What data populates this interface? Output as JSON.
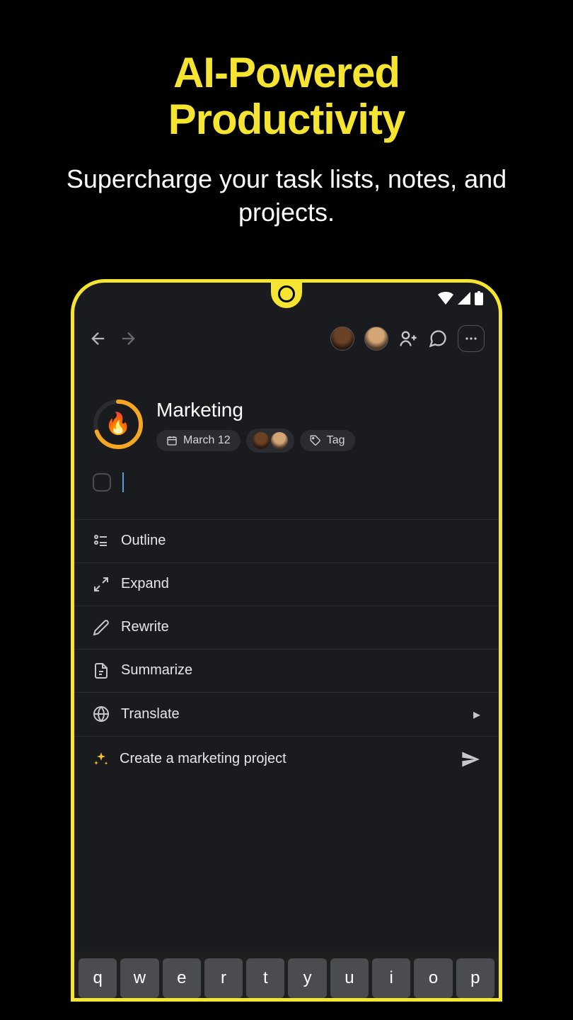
{
  "hero": {
    "title_line1": "AI-Powered",
    "title_line2": "Productivity",
    "subtitle": "Supercharge your task lists, notes, and projects."
  },
  "project": {
    "title": "Marketing",
    "emoji": "🔥",
    "date": "March 12",
    "tag_label": "Tag"
  },
  "ai_menu": [
    {
      "label": "Outline",
      "icon": "outline"
    },
    {
      "label": "Expand",
      "icon": "expand"
    },
    {
      "label": "Rewrite",
      "icon": "rewrite"
    },
    {
      "label": "Summarize",
      "icon": "summarize"
    },
    {
      "label": "Translate",
      "icon": "translate",
      "arrow": true
    }
  ],
  "prompt": {
    "text": "Create a marketing project"
  },
  "keyboard_row": [
    "q",
    "w",
    "e",
    "r",
    "t",
    "y",
    "u",
    "i",
    "o",
    "p"
  ]
}
